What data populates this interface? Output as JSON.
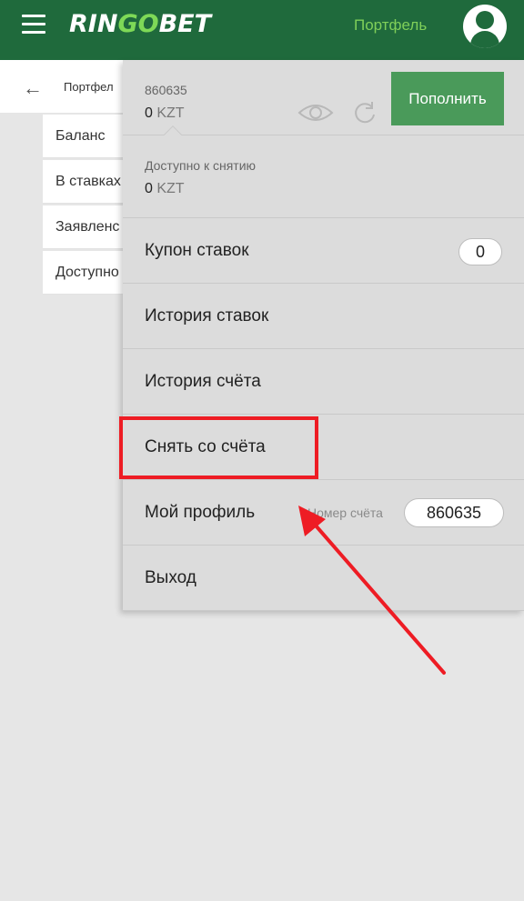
{
  "header": {
    "logo_part1": "RIN",
    "logo_part2": "GO",
    "logo_part3": "BET",
    "portfolio_link": "Портфель"
  },
  "background_page": {
    "title": "Портфел",
    "cards": [
      "Баланс",
      "В ставках",
      "Заявленс",
      "Доступно"
    ]
  },
  "account": {
    "number": "860635",
    "balance_value": "0",
    "currency": "KZT",
    "topup_label": "Пополнить",
    "available_label": "Доступно к снятию",
    "available_value": "0",
    "available_currency": "KZT"
  },
  "menu": {
    "coupon_label": "Купон ставок",
    "coupon_count": "0",
    "bet_history_label": "История ставок",
    "account_history_label": "История счёта",
    "withdraw_label": "Снять со счёта",
    "profile_label": "Мой профиль",
    "account_number_label": "Номер счёта",
    "account_number_value": "860635",
    "logout_label": "Выход"
  },
  "colors": {
    "header_bg": "#1f6a3c",
    "topup_button": "#4a9a5a",
    "annotation_red": "#ee1c24"
  }
}
